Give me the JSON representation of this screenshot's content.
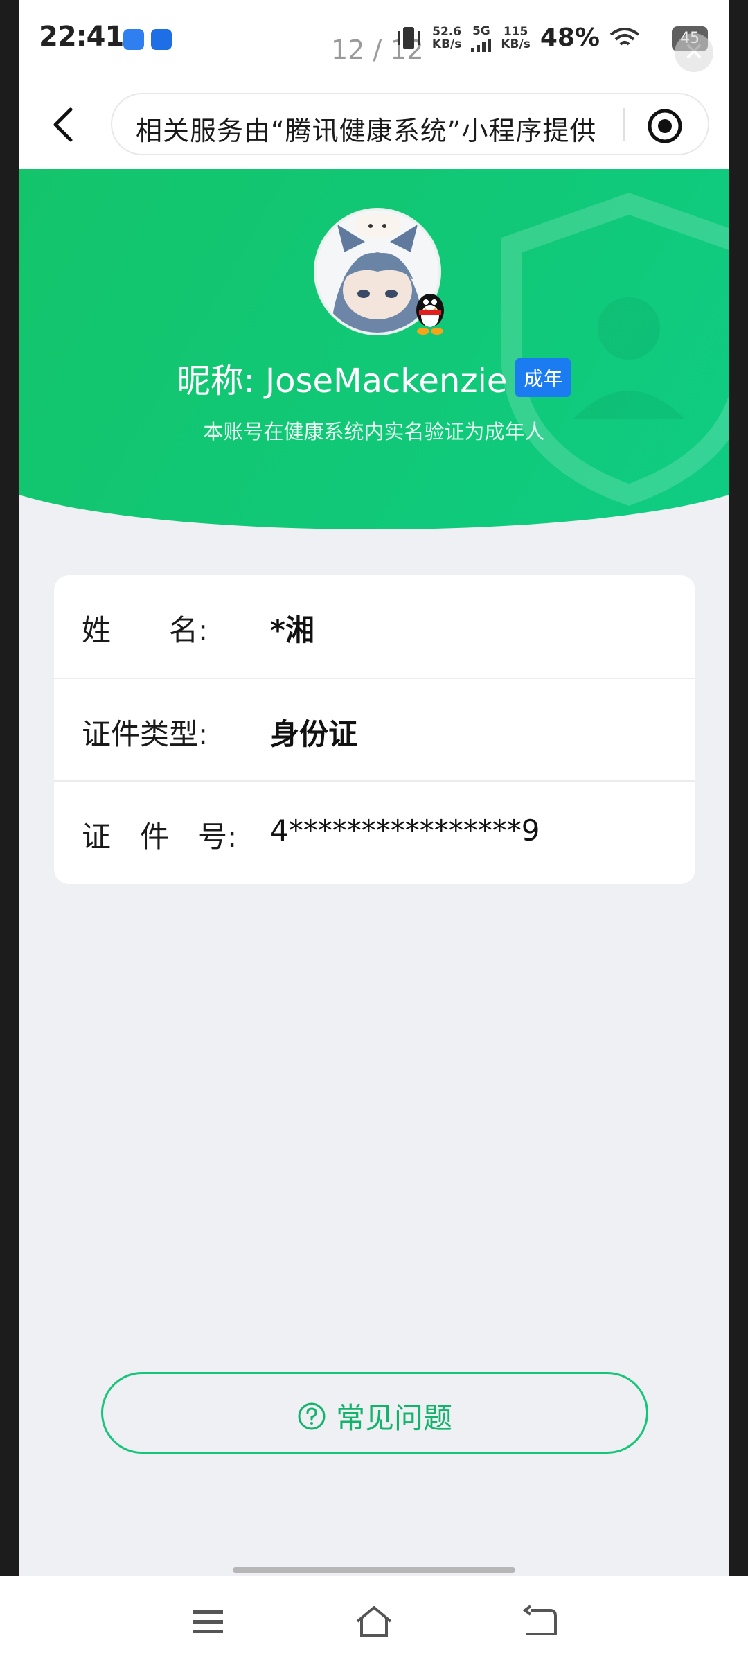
{
  "status_bar": {
    "time": "22:41",
    "page_counter": "12 / 12",
    "net_speed_1": "52.6",
    "net_speed_1_unit": "KB/s",
    "network_type": "5G",
    "net_speed_2": "115",
    "net_speed_2_unit": "KB/s",
    "battery_text": "48%",
    "battery_badge": "45",
    "close_glyph": "✕"
  },
  "nav": {
    "title": "相关服务由“腾讯健康系统”小程序提供"
  },
  "profile": {
    "nickname": "昵称: JoseMackenzie",
    "adult_badge": "成年",
    "verify_text": "本账号在健康系统内实名验证为成年人"
  },
  "info": {
    "rows": [
      {
        "label": "姓　　名:",
        "value": "*湘"
      },
      {
        "label": "证件类型:",
        "value": "身份证"
      },
      {
        "label": "证　件　号:",
        "value": "4****************9"
      }
    ]
  },
  "faq": {
    "label": "常见问题"
  },
  "colors": {
    "brand_green": "#14c46a",
    "badge_blue": "#1a7cf0",
    "faq_green": "#13b36c"
  }
}
